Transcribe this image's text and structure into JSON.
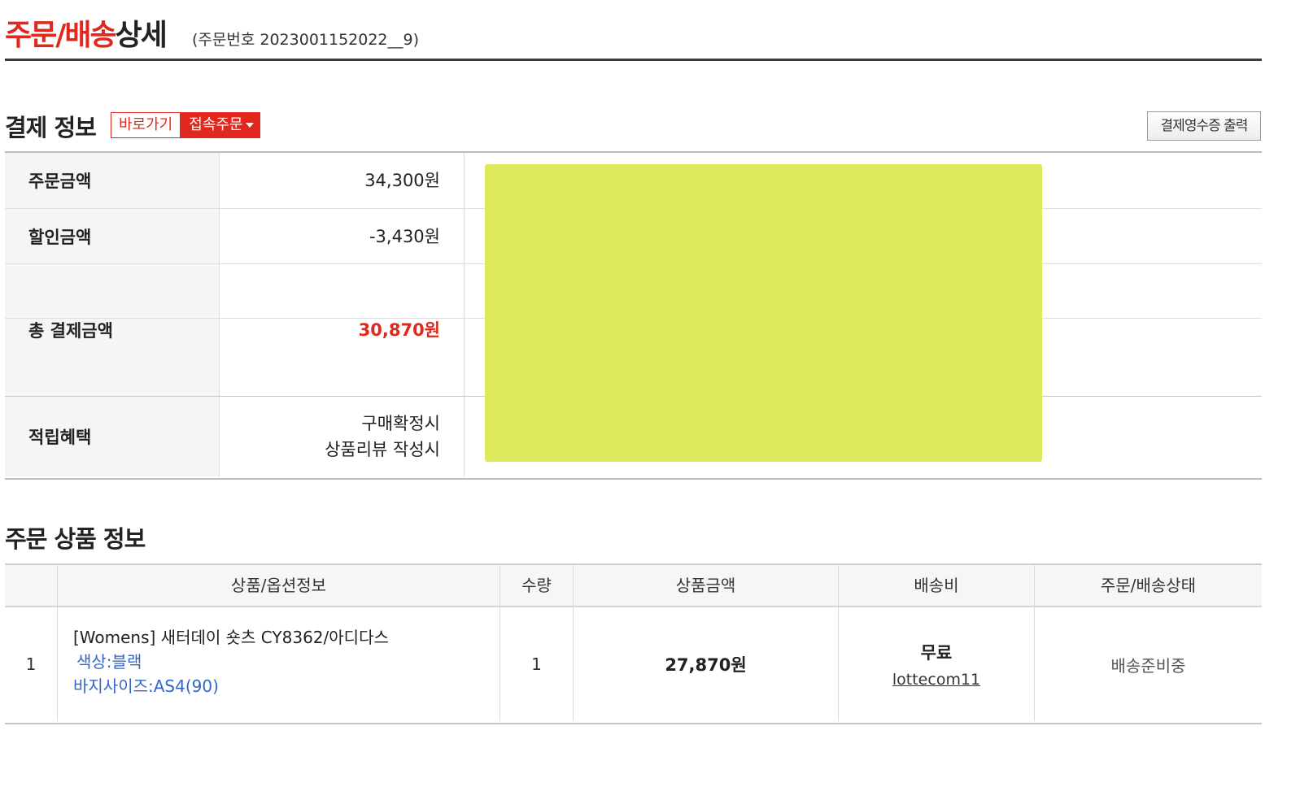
{
  "header": {
    "title_accent": "주문/배송",
    "title_rest": "상세",
    "order_no": "(주문번호 2023001152022__9)"
  },
  "payment": {
    "section_title": "결제 정보",
    "shortcut_label": "바로가기",
    "shortcut_button": "접속주문",
    "receipt_button": "결제영수증 출력",
    "rows": [
      {
        "label": "주문금액",
        "value": "34,300원"
      },
      {
        "label": "할인금액",
        "value": "-3,430원"
      },
      {
        "label": "총 결제금액",
        "value": "30,870원"
      },
      {
        "label": "적립혜택",
        "value_line1": "구매확정시",
        "value_line2": "상품리뷰 작성시"
      }
    ]
  },
  "products": {
    "section_title": "주문 상품 정보",
    "columns": [
      "상품/옵션정보",
      "수량",
      "상품금액",
      "배송비",
      "주문/배송상태"
    ],
    "items": [
      {
        "no": "1",
        "name": "[Womens] 새터데이 숏츠 CY8362/아디다스",
        "option_color": "색상:블랙",
        "option_size": "바지사이즈:AS4(90)",
        "qty": "1",
        "price": "27,870원",
        "shipping_fee": "무료",
        "seller": "lottecom11",
        "status": "배송준비중"
      }
    ]
  },
  "colors": {
    "accent": "#e0281e",
    "option_link": "#3466c7",
    "redaction": "#dde95c"
  }
}
